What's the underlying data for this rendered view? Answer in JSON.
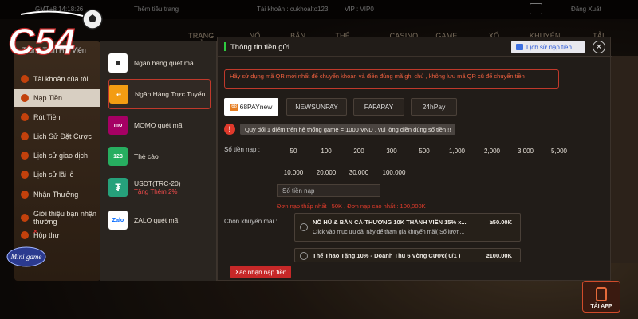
{
  "topbar": {
    "gmt": "GMT+8 14:18:26",
    "guide": "Thêm tiêu trang",
    "account": "Tài khoản : cukhoalto123",
    "vip": "VIP : VIP0",
    "logout": "Đăng Xuất"
  },
  "brand": {
    "logo_text": "C54",
    "mini_logo_text": "Mini game",
    "accent": "#c62828"
  },
  "nav": [
    "TRANG CHỦ",
    "NỔ HŨ",
    "BẮN CÁ",
    "THỂ THAO",
    "CASINO",
    "GAME BÀI",
    "XỔ SỐ",
    "KHUYẾN MÃI",
    "TẢI APP"
  ],
  "sidebar": {
    "title": "Trung Tâm Hội Viên",
    "items": [
      {
        "label": "Tài khoản của tôi"
      },
      {
        "label": "Nạp Tiền"
      },
      {
        "label": "Rút Tiền"
      },
      {
        "label": "Lịch Sử Đặt Cược"
      },
      {
        "label": "Lịch sử giao dịch"
      },
      {
        "label": "Lịch sử lãi lỗ"
      },
      {
        "label": "Nhận Thưởng"
      },
      {
        "label": "Giới thiệu bạn nhận thưởng"
      },
      {
        "label": "Hộp thư"
      }
    ]
  },
  "methods": [
    {
      "label": "Ngân hàng quét mã",
      "sub": ""
    },
    {
      "label": "Ngân Hàng Trực Tuyến",
      "sub": ""
    },
    {
      "label": "MOMO quét mã",
      "sub": ""
    },
    {
      "label": "Thẻ cào",
      "sub": ""
    },
    {
      "label": "USDT(TRC-20)",
      "sub": "Tặng Thêm 2%"
    },
    {
      "label": "ZALO quét mã",
      "sub": ""
    }
  ],
  "modal": {
    "title": "Thông tin tiền gửi",
    "history_label": "Lịch sử nạp tiền",
    "close_icon": "close-icon",
    "notice": "Hãy sử dụng mã QR mới nhất để chuyển khoản và điền đúng mã ghi chú , không lưu mã QR cũ để chuyển tiền",
    "gateways": [
      "68PAYnew",
      "NEWSUNPAY",
      "FAFAPAY",
      "24hPay"
    ],
    "gateway_icon_text": "68",
    "exchange_info": "Quy đổi 1 điểm trên hệ thống game = 1000 VND , vui lòng điền đúng số tiền !!",
    "amount_label": "Số tiền nạp :",
    "amounts_row1": [
      "50",
      "100",
      "200",
      "300",
      "500",
      "1,000",
      "2,000",
      "3,000",
      "5,000"
    ],
    "amounts_row2": [
      "10,000",
      "20,000",
      "30,000",
      "100,000"
    ],
    "amount_placeholder": "Số tiền nạp",
    "limits": "Đơn nạp thấp nhất : 50K , Đơn nạp cao nhất : 100,000K",
    "promo_label": "Chọn khuyến mãi :",
    "promos": [
      {
        "title": "NỔ HŨ & BẮN CÁ-THƯƠNG 10K THÀNH VIÊN 15% x...",
        "desc": "Click vào mục ưu đãi này để tham gia khuyến mãi( Số lượn...",
        "amount": "≥50.00K"
      },
      {
        "title": "Thể Thao Tặng 10% - Doanh Thu 6 Vòng Cược( 0/1 )",
        "desc": "",
        "amount": "≥100.00K"
      }
    ],
    "submit_label": "Xác nhận nạp tiền"
  },
  "tai_app": "TẢI APP"
}
